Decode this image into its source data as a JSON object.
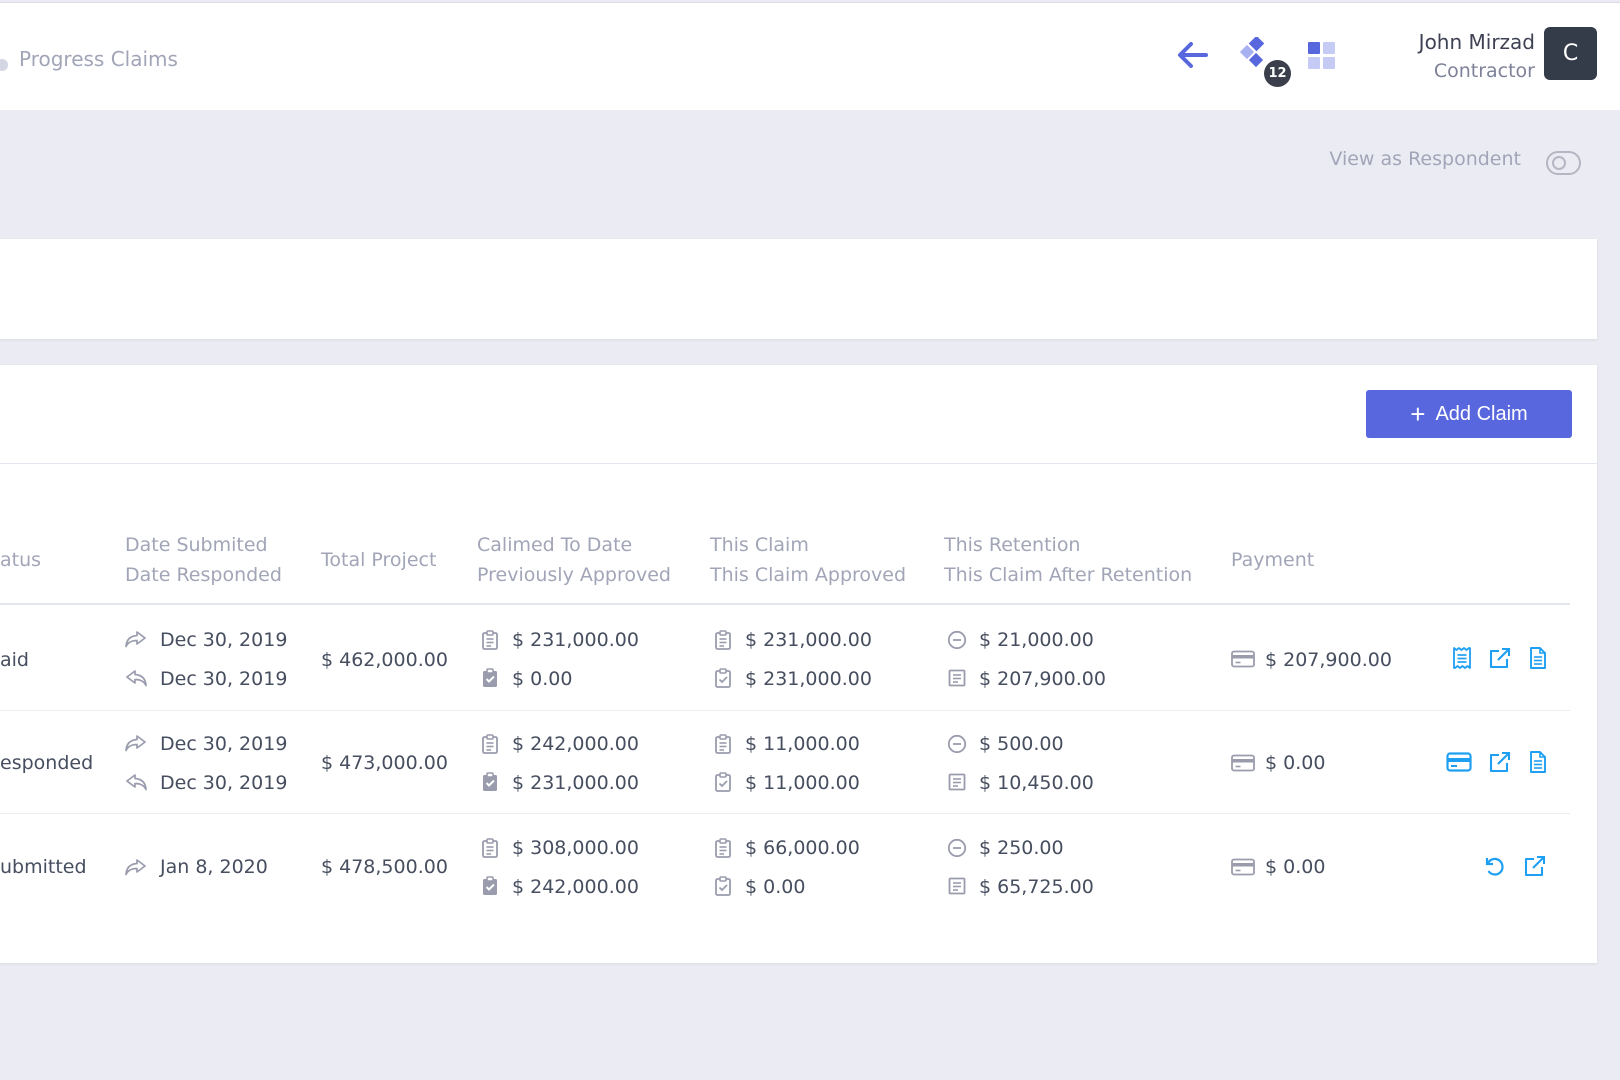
{
  "header": {
    "breadcrumb": "Progress Claims",
    "notification_count": "12",
    "user_name": "John Mirzad",
    "user_role": "Contractor",
    "avatar_letter": "C",
    "icons": [
      "arrow-left-icon",
      "layers-icon",
      "apps-grid-icon"
    ]
  },
  "toolbar": {
    "view_as_respondent_label": "View as Respondent",
    "view_as_respondent_on": false
  },
  "claims": {
    "add_button_label": "Add Claim",
    "columns": {
      "status": "atus",
      "date_submitted": "Date Submited",
      "date_responded": "Date Responded",
      "total_project": "Total Project",
      "claimed_to_date": "Calimed To Date",
      "previously_approved": "Previously Approved",
      "this_claim": "This Claim",
      "this_claim_approved": "This Claim Approved",
      "this_retention": "This Retention",
      "after_retention": "This Claim After Retention",
      "payment": "Payment"
    },
    "rows": [
      {
        "status": "aid",
        "date_submitted": "Dec 30, 2019",
        "date_responded": "Dec 30, 2019",
        "total_project": "$ 462,000.00",
        "claimed_to_date": "$ 231,000.00",
        "previously_approved": "$ 0.00",
        "this_claim": "$ 231,000.00",
        "this_claim_approved": "$ 231,000.00",
        "this_retention": "$ 21,000.00",
        "after_retention": "$ 207,900.00",
        "payment": "$ 207,900.00"
      },
      {
        "status": "esponded",
        "date_submitted": "Dec 30, 2019",
        "date_responded": "Dec 30, 2019",
        "total_project": "$ 473,000.00",
        "claimed_to_date": "$ 242,000.00",
        "previously_approved": "$ 231,000.00",
        "this_claim": "$ 11,000.00",
        "this_claim_approved": "$ 11,000.00",
        "this_retention": "$ 500.00",
        "after_retention": "$ 10,450.00",
        "payment": "$ 0.00"
      },
      {
        "status": "ubmitted",
        "date_submitted": "Jan 8, 2020",
        "total_project": "$ 478,500.00",
        "claimed_to_date": "$ 308,000.00",
        "previously_approved": "$ 242,000.00",
        "this_claim": "$ 66,000.00",
        "this_claim_approved": "$ 0.00",
        "this_retention": "$ 250.00",
        "after_retention": "$ 65,725.00",
        "payment": "$ 0.00"
      }
    ]
  },
  "colors": {
    "accent": "#5867dd",
    "action_icon": "#1e9ff2",
    "muted_text": "#a1a5b7",
    "avatar_bg": "#333c48"
  }
}
